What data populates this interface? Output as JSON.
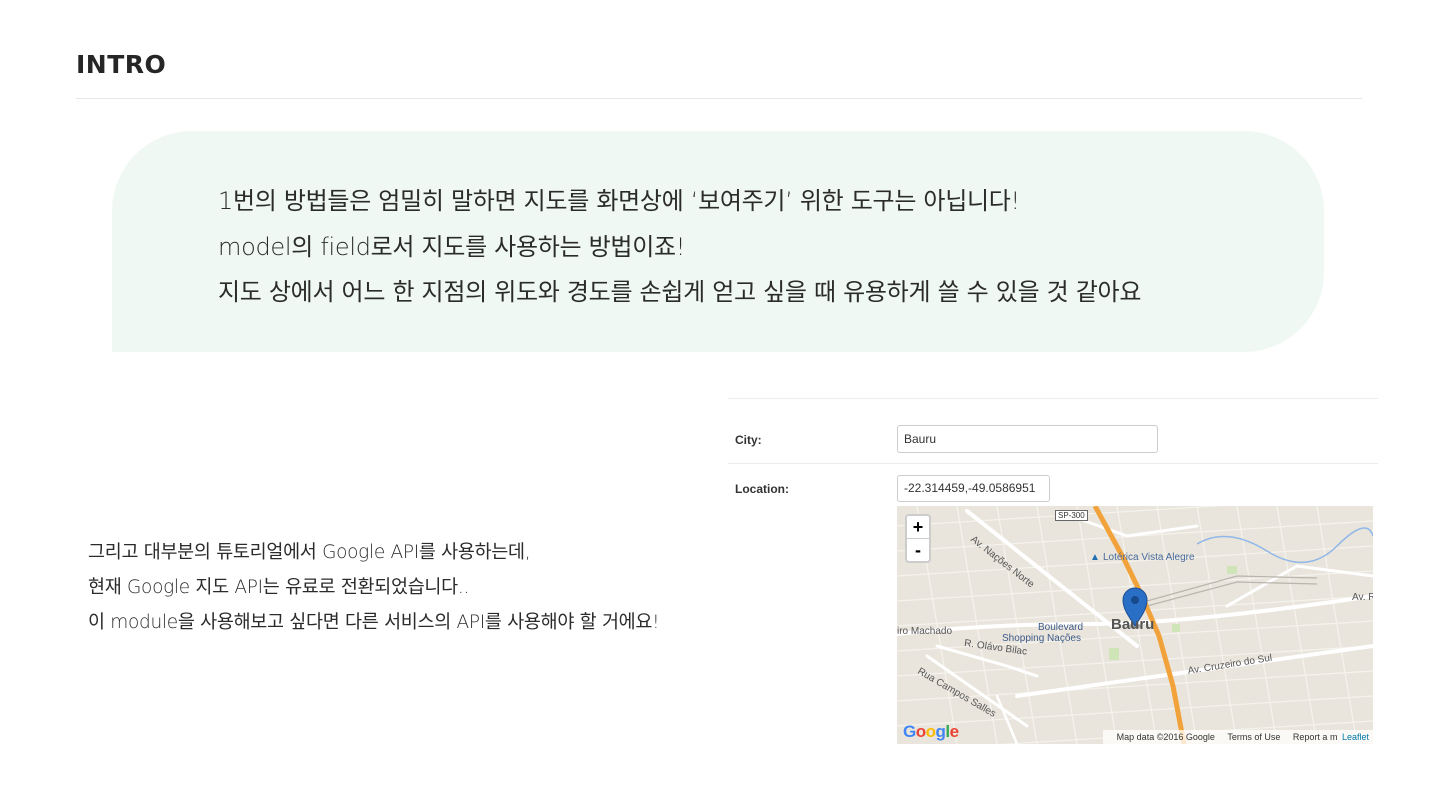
{
  "header": {
    "title": "INTRO"
  },
  "bubble": {
    "lines": [
      "1번의 방법들은 엄밀히 말하면 지도를 화면상에 ‘보여주기’ 위한 도구는 아닙니다!",
      "model의 field로서 지도를 사용하는 방법이죠!",
      "지도 상에서 어느 한 지점의 위도와 경도를 손쉽게 얻고 싶을 때 유용하게 쓸 수 있을 것 같아요"
    ]
  },
  "description": {
    "lines": [
      "그리고 대부분의 튜토리얼에서 Google API를 사용하는데,",
      "현재 Google 지도 API는 유료로 전환되었습니다..",
      "이 module을 사용해보고 싶다면 다른 서비스의 API를 사용해야 할 거에요!"
    ]
  },
  "form": {
    "city_label": "City:",
    "city_value": "Bauru",
    "location_label": "Location:",
    "location_value": "-22.314459,-49.0586951"
  },
  "map": {
    "zoom_in": "+",
    "zoom_out": "-",
    "road_shield": "SP-300",
    "labels": {
      "nacoes_norte": "Av. Nações Norte",
      "loterica": "Lotérica Vista Alegre",
      "av_r": "Av. R",
      "machado": "iro Machado",
      "olavo_bilac": "R. Olávo Bilac",
      "boulevard": "Boulevard",
      "shopping": "Shopping Nações",
      "bauru": "Bauru",
      "cruzeiro": "Av. Cruzeiro do Sul",
      "campos_salles": "Rua Campos Salles"
    },
    "logo": "Google",
    "attribution": {
      "map_data": "Map data ©2016 Google",
      "terms": "Terms of Use",
      "report": "Report a m",
      "leaflet": "Leaflet"
    },
    "colors": {
      "highway": "#f2a23a",
      "pin": "#2a6fc6"
    }
  }
}
